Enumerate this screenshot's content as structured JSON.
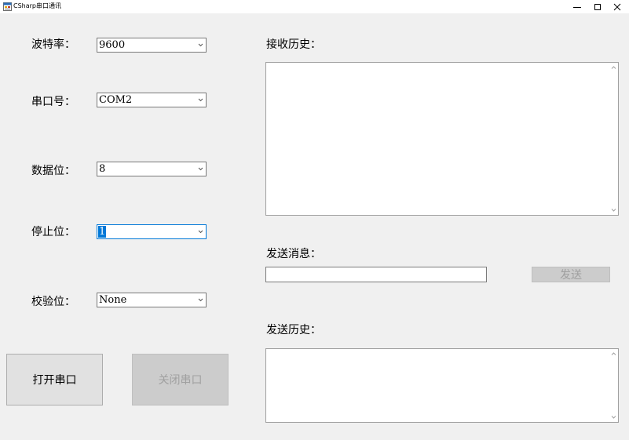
{
  "window": {
    "title": "CSharp串口通讯",
    "icon": "form-icon",
    "controls": {
      "minimize": "—",
      "maximize": "☐",
      "close": "✕"
    }
  },
  "settings": {
    "baud": {
      "label": "波特率：",
      "value": "9600"
    },
    "port": {
      "label": "串口号：",
      "value": "COM2"
    },
    "databits": {
      "label": "数据位：",
      "value": "8"
    },
    "stopbits": {
      "label": "停止位：",
      "value": "1"
    },
    "parity": {
      "label": "校验位：",
      "value": "None"
    }
  },
  "buttons": {
    "open": {
      "label": "打开串口",
      "enabled": true
    },
    "close": {
      "label": "关闭串口",
      "enabled": false
    },
    "send": {
      "label": "发送",
      "enabled": false
    }
  },
  "receive": {
    "label": "接收历史：",
    "content": ""
  },
  "send_message": {
    "label": "发送消息：",
    "value": ""
  },
  "send_history": {
    "label": "发送历史：",
    "content": ""
  },
  "colors": {
    "background": "#f0f0f0",
    "focus": "#0078d7",
    "disabled_text": "#a0a0a0"
  }
}
